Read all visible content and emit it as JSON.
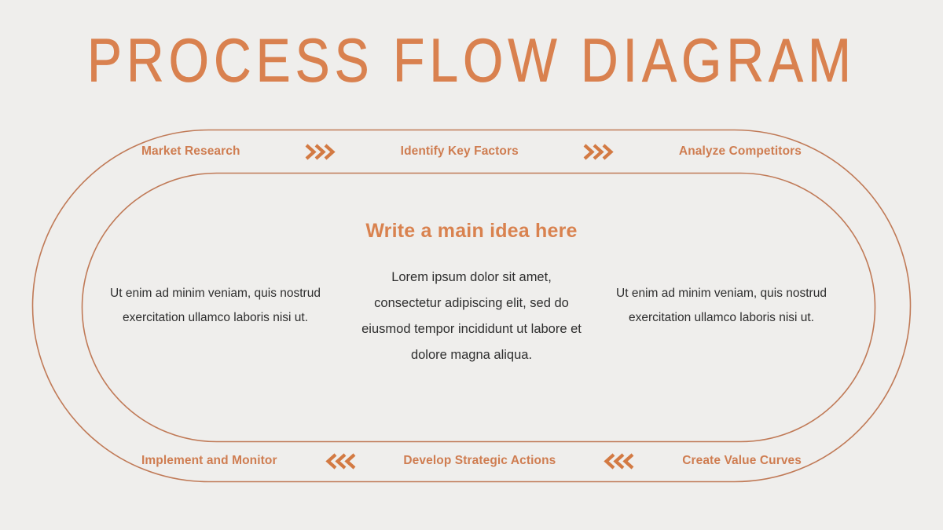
{
  "page": {
    "title": "PROCESS FLOW DIAGRAM",
    "background_color": "#efeeec",
    "accent_color": "#cf7d51",
    "stroke_color": "#c07a57",
    "body_text_color": "#2e2e2e"
  },
  "flow": {
    "top_row": {
      "direction": "right",
      "arrow_icon": "chevron-right-triple-icon",
      "steps": [
        {
          "label": "Market Research"
        },
        {
          "label": "Identify Key Factors"
        },
        {
          "label": "Analyze Competitors"
        }
      ]
    },
    "bottom_row": {
      "direction": "left",
      "arrow_icon": "chevron-left-triple-icon",
      "steps": [
        {
          "label": "Implement and Monitor"
        },
        {
          "label": "Develop Strategic Actions"
        },
        {
          "label": "Create Value Curves"
        }
      ]
    }
  },
  "center": {
    "heading": "Write a main idea here",
    "body": "Lorem ipsum dolor sit amet, consectetur adipiscing elit, sed do eiusmod tempor incididunt ut labore et dolore magna aliqua."
  },
  "left_column": {
    "body": "Ut enim ad minim veniam, quis nostrud exercitation ullamco laboris nisi ut."
  },
  "right_column": {
    "body": "Ut enim ad minim veniam, quis nostrud exercitation ullamco laboris nisi ut."
  }
}
